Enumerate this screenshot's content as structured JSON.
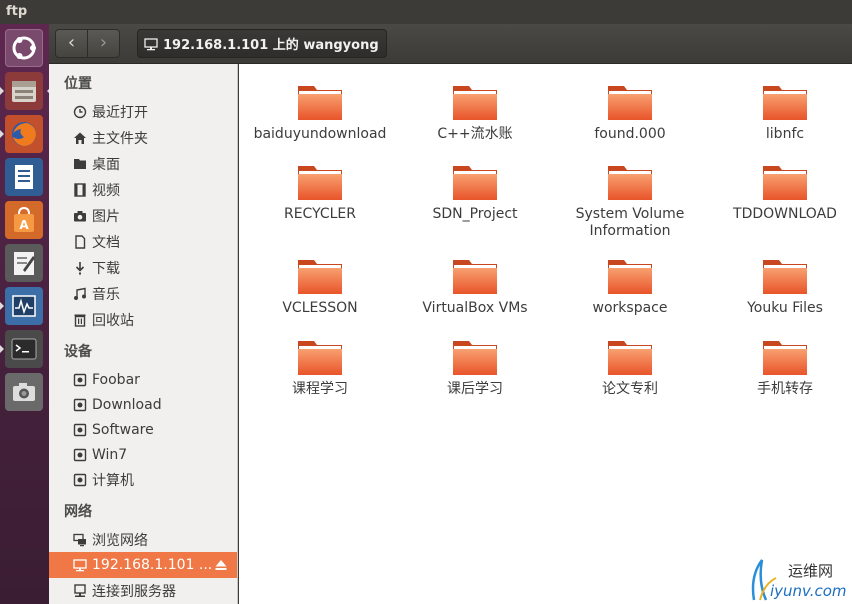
{
  "window": {
    "title": "ftp"
  },
  "launcher": {
    "items": [
      {
        "icon": "ubuntu-dash-icon"
      },
      {
        "icon": "file-manager-icon"
      },
      {
        "icon": "firefox-icon"
      },
      {
        "icon": "writer-icon"
      },
      {
        "icon": "software-center-icon"
      },
      {
        "icon": "text-editor-icon"
      },
      {
        "icon": "system-monitor-icon"
      },
      {
        "icon": "terminal-icon"
      },
      {
        "icon": "camera-icon"
      }
    ]
  },
  "toolbar": {
    "back_glyph": "‹",
    "forward_glyph": "›",
    "path_label": "192.168.1.101 上的 wangyong"
  },
  "sidebar": {
    "sections": {
      "places": "位置",
      "devices": "设备",
      "network": "网络"
    },
    "places": [
      {
        "label": "最近打开",
        "icon": "clock-icon"
      },
      {
        "label": "主文件夹",
        "icon": "home-icon"
      },
      {
        "label": "桌面",
        "icon": "desktop-folder-icon"
      },
      {
        "label": "视频",
        "icon": "video-icon"
      },
      {
        "label": "图片",
        "icon": "camera-icon"
      },
      {
        "label": "文档",
        "icon": "document-icon"
      },
      {
        "label": "下载",
        "icon": "download-icon"
      },
      {
        "label": "音乐",
        "icon": "music-icon"
      },
      {
        "label": "回收站",
        "icon": "trash-icon"
      }
    ],
    "devices": [
      {
        "label": "Foobar",
        "icon": "drive-icon"
      },
      {
        "label": "Download",
        "icon": "drive-icon"
      },
      {
        "label": "Software",
        "icon": "drive-icon"
      },
      {
        "label": "Win7",
        "icon": "drive-icon"
      },
      {
        "label": "计算机",
        "icon": "drive-icon"
      }
    ],
    "network": [
      {
        "label": "浏览网络",
        "icon": "network-icon"
      },
      {
        "label": "192.168.1.101 ...",
        "icon": "network-share-icon",
        "active": true
      },
      {
        "label": "连接到服务器",
        "icon": "server-icon"
      }
    ]
  },
  "files": [
    "baiduyundownload",
    "C++流水账",
    "found.000",
    "libnfc",
    "RECYCLER",
    "SDN_Project",
    "System Volume Information",
    "TDDOWNLOAD",
    "VCLESSON",
    "VirtualBox VMs",
    "workspace",
    "Youku Files",
    "课程学习",
    "课后学习",
    "论文专利",
    "手机转存"
  ],
  "watermark": {
    "line1": "运维网",
    "line2": "iyunv.com"
  },
  "colors": {
    "accent": "#f07746",
    "folder": "#e8542a",
    "launcher": "#5e2750"
  }
}
